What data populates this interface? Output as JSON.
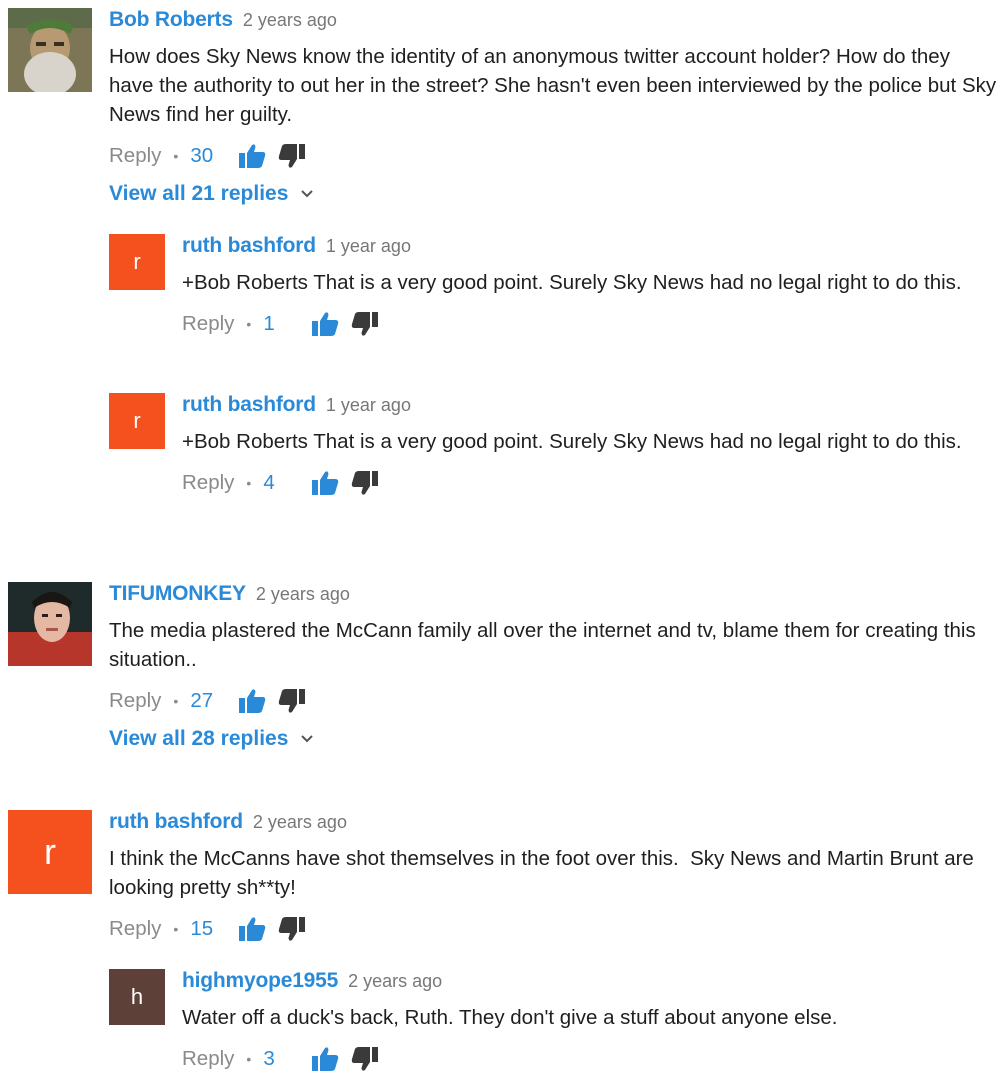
{
  "ui": {
    "reply_label": "Reply",
    "separator": "•"
  },
  "colors": {
    "link_blue": "#2a8ad8",
    "avatar_orange": "#f4511e",
    "avatar_brown": "#5d4037",
    "meta_gray": "#777777"
  },
  "comments": [
    {
      "author": "Bob Roberts",
      "time": "2 years ago",
      "text": "How does Sky News know the identity of an anonymous twitter account holder? How do they have the authority to out her in the street? She hasn't even been interviewed by the police but Sky News find her guilty.",
      "likes": "30",
      "avatar_icon": "statue-photo-avatar",
      "view_replies": "View all 21 replies",
      "replies": [
        {
          "author": "ruth bashford",
          "time": "1 year ago",
          "text": "+Bob Roberts That is a very good point. Surely Sky News had no legal right to do this.",
          "likes": "1",
          "avatar_letter": "r"
        },
        {
          "author": "ruth bashford",
          "time": "1 year ago",
          "text": "+Bob Roberts That is a very good point. Surely Sky News had no legal right to do this.",
          "likes": "4",
          "avatar_letter": "r"
        }
      ]
    },
    {
      "author": "TIFUMONKEY",
      "time": "2 years ago",
      "text": "The media plastered the McCann family all over the internet and tv, blame them for creating this situation..",
      "likes": "27",
      "avatar_icon": "man-photo-avatar",
      "view_replies": "View all 28 replies"
    },
    {
      "author": "ruth bashford",
      "time": "2 years ago",
      "text": "I think the McCanns have shot themselves in the foot over this.  Sky News and Martin Brunt are looking pretty sh**ty!",
      "likes": "15",
      "avatar_letter": "r",
      "replies": [
        {
          "author": "highmyope1955",
          "time": "2 years ago",
          "text": "Water off a duck's back, Ruth. They don't give a stuff about anyone else.",
          "likes": "3",
          "avatar_letter": "h"
        }
      ]
    }
  ]
}
